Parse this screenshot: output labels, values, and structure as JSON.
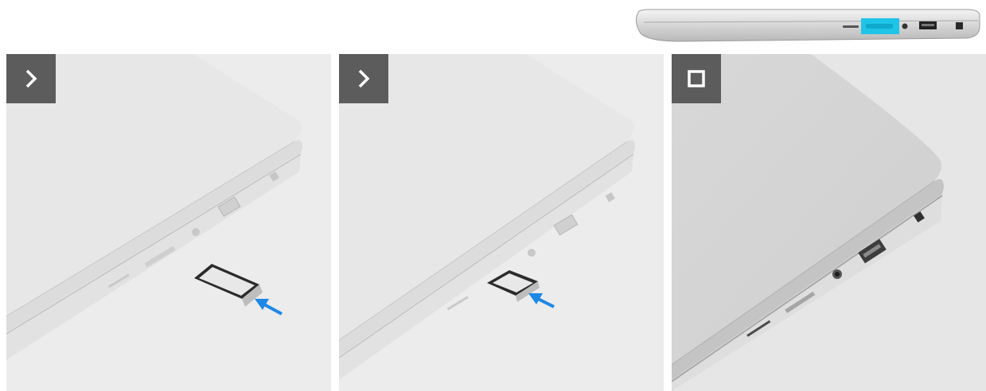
{
  "figure": {
    "side_view": {
      "icon": "laptop-side-view-icon",
      "highlight_color": "#1fc4e8",
      "highlighted_port": "sd-card-tray-slot"
    },
    "steps": [
      {
        "badge_icon": "chevron-right-icon",
        "badge_meaning": "next-step",
        "arrow_color": "#1e88e5",
        "scene": "sim-card-tray-aligned-with-slot"
      },
      {
        "badge_icon": "chevron-right-icon",
        "badge_meaning": "next-step",
        "arrow_color": "#1e88e5",
        "scene": "sim-card-tray-partially-inserted"
      },
      {
        "badge_icon": "stop-square-icon",
        "badge_meaning": "final-step",
        "scene": "sim-card-tray-fully-inserted"
      }
    ],
    "colors": {
      "badge": "#5c5c5c",
      "arrow": "#1e88e5",
      "highlight": "#1fc4e8",
      "chassis": "#e4e4e4"
    }
  }
}
